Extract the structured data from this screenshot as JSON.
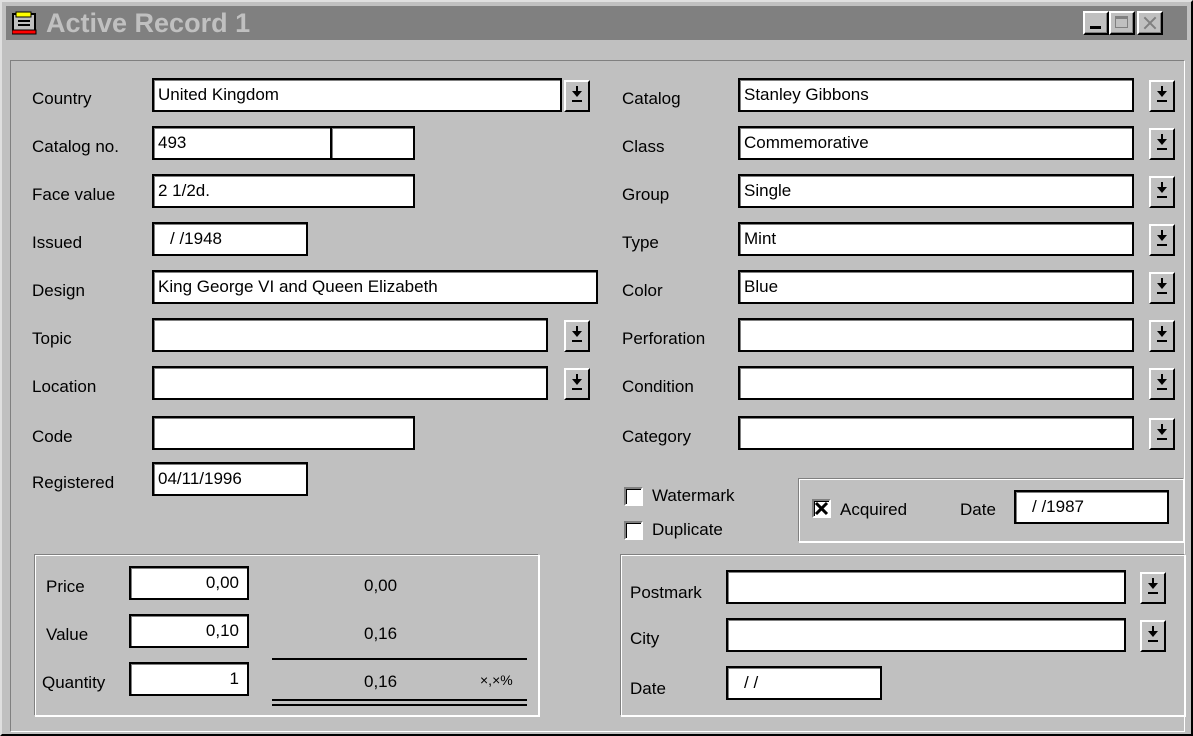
{
  "window": {
    "title": "Active Record 1"
  },
  "left": {
    "country": {
      "label": "Country",
      "value": "United Kingdom"
    },
    "catalog_no": {
      "label": "Catalog no.",
      "value": "493",
      "value2": ""
    },
    "face_value": {
      "label": "Face value",
      "value": "2 1/2d."
    },
    "issued": {
      "label": "Issued",
      "value": " /  /1948"
    },
    "design": {
      "label": "Design",
      "value": "King George VI and Queen Elizabeth"
    },
    "topic": {
      "label": "Topic",
      "value": ""
    },
    "location": {
      "label": "Location",
      "value": ""
    },
    "code": {
      "label": "Code",
      "value": ""
    },
    "registered": {
      "label": "Registered",
      "value": "04/11/1996"
    }
  },
  "right": {
    "catalog": {
      "label": "Catalog",
      "value": "Stanley Gibbons"
    },
    "class": {
      "label": "Class",
      "value": "Commemorative"
    },
    "group": {
      "label": "Group",
      "value": "Single"
    },
    "type": {
      "label": "Type",
      "value": "Mint"
    },
    "color": {
      "label": "Color",
      "value": "Blue"
    },
    "perforation": {
      "label": "Perforation",
      "value": ""
    },
    "condition": {
      "label": "Condition",
      "value": ""
    },
    "category": {
      "label": "Category",
      "value": ""
    }
  },
  "checks": {
    "watermark": {
      "label": "Watermark",
      "checked": false
    },
    "duplicate": {
      "label": "Duplicate",
      "checked": false
    },
    "acquired": {
      "label": "Acquired",
      "checked": true,
      "date_label": "Date",
      "date_value": " /  /1987"
    }
  },
  "money": {
    "price": {
      "label": "Price",
      "value": "0,00",
      "computed": "0,00"
    },
    "value": {
      "label": "Value",
      "value": "0,10",
      "computed": "0,16"
    },
    "quantity": {
      "label": "Quantity",
      "value": "1",
      "computed": "0,16"
    },
    "percent_symbol": "×,×%"
  },
  "postmark": {
    "postmark": {
      "label": "Postmark",
      "value": ""
    },
    "city": {
      "label": "City",
      "value": ""
    },
    "date": {
      "label": "Date",
      "value": " /  /"
    }
  }
}
